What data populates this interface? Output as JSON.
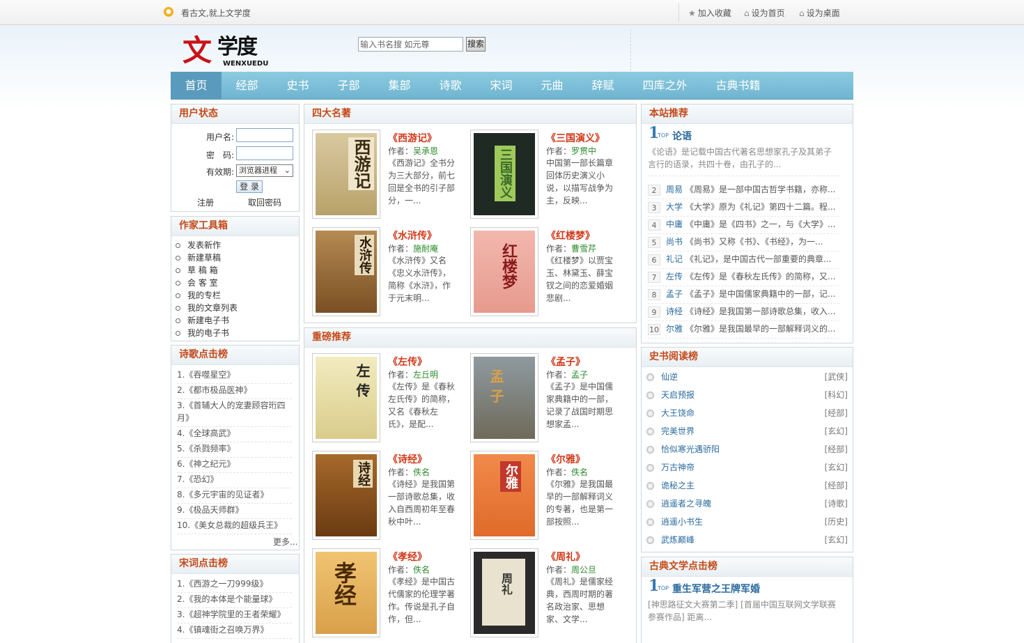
{
  "top": {
    "slogan": "看古文,就上文学度",
    "fav": "加入收藏",
    "home": "设为首页",
    "desk": "设为桌面"
  },
  "logo": {
    "cn_big": "文",
    "cn_small": "学度",
    "en": "WENXUEDU"
  },
  "search": {
    "placeholder": "输入书名搜 如元尊",
    "button": "搜索"
  },
  "nav": [
    "首页",
    "经部",
    "史书",
    "子部",
    "集部",
    "诗歌",
    "宋词",
    "元曲",
    "辞赋",
    "四库之外",
    "古典书籍"
  ],
  "user": {
    "title": "用户状态",
    "username": "用户名:",
    "password": "密　码:",
    "expiry": "有效期:",
    "expiry_value": "浏览器进程",
    "login": "登 录",
    "register": "注册",
    "forgot": "取回密码"
  },
  "tools": {
    "title": "作家工具箱",
    "items": [
      "发表新作",
      "新建草稿",
      "草 稿 箱",
      "会 客 室",
      "我的专栏",
      "我的文章列表",
      "新建电子书",
      "我的电子书"
    ]
  },
  "poem_rank": {
    "title": "诗歌点击榜",
    "items": [
      "1.《吞噬星空》",
      "2.《都市极品医神》",
      "3.《首辅大人的宠妻顾容珩四月》",
      "4.《全球高武》",
      "5.《杀戮频率》",
      "6.《神之纪元》",
      "7.《恐幻》",
      "8.《多元宇宙的见证者》",
      "9.《极品天师群》",
      "10.《美女总裁的超级兵王》"
    ],
    "more": "更多..."
  },
  "song_rank": {
    "title": "宋词点击榜",
    "items": [
      "1.《西游之一刀999级》",
      "2.《我的本体是个能量球》",
      "3.《超神学院里的王者荣耀》",
      "4.《镇魂街之召唤万界》"
    ]
  },
  "classics": {
    "title": "四大名著",
    "books": [
      {
        "title": "《西游记》",
        "author_label": "作者：",
        "author": "吴承恩",
        "desc": "《西游记》全书分为三大部分，前七回是全书的引子部分，一...",
        "cover": "西游记"
      },
      {
        "title": "《三国演义》",
        "author_label": "作者：",
        "author": "罗贯中",
        "desc": "中国第一部长篇章回体历史演义小说，以描写战争为主，反映...",
        "cover": "三国演义"
      },
      {
        "title": "《水浒传》",
        "author_label": "作者：",
        "author": "施耐庵",
        "desc": "《水浒传》又名《忠义水浒传》，简称《水浒》，作于元末明...",
        "cover": "水浒传"
      },
      {
        "title": "《红楼梦》",
        "author_label": "作者：",
        "author": "曹雪芹",
        "desc": "《红楼梦》以贾宝玉、林黛玉、薛宝钗之间的恋爱婚姻悲剧...",
        "cover": "红楼梦"
      }
    ]
  },
  "featured": {
    "title": "重磅推荐",
    "books": [
      {
        "title": "《左传》",
        "author_label": "作者：",
        "author": "左丘明",
        "desc": "《左传》是《春秋左氏传》的简称，又名《春秋左氏》，是配...",
        "cover": "左传"
      },
      {
        "title": "《孟子》",
        "author_label": "作者：",
        "author": "孟子",
        "desc": "《孟子》是中国儒家典籍中的一部，记录了战国时期思想家孟...",
        "cover": "孟子"
      },
      {
        "title": "《诗经》",
        "author_label": "作者：",
        "author": "佚名",
        "desc": "《诗经》是我国第一部诗歌总集，收入自西周初年至春秋中叶...",
        "cover": "诗经"
      },
      {
        "title": "《尔雅》",
        "author_label": "作者：",
        "author": "佚名",
        "desc": "《尔雅》是我国最早的一部解释词义的专著，也是第一部按照...",
        "cover": "尔雅"
      },
      {
        "title": "《孝经》",
        "author_label": "作者：",
        "author": "佚名",
        "desc": "《孝经》是中国古代儒家的伦理学著作。传说是孔子自作，但...",
        "cover": "孝经"
      },
      {
        "title": "《周礼》",
        "author_label": "作者：",
        "author": "周公旦",
        "desc": "《周礼》是儒家经典，西周时期的著名政治家、思想家、文学...",
        "cover": "周礼"
      }
    ]
  },
  "recommend": {
    "title": "本站推荐",
    "top_label": "TOP",
    "top_title": "论语",
    "top_desc": "《论语》是记载中国古代著名思想家孔子及其弟子言行的语录，共四十卷，由孔子的...",
    "items": [
      {
        "n": "2",
        "kw": "周易",
        "txt": "《周易》是一部中国古哲学书籍，亦称..."
      },
      {
        "n": "3",
        "kw": "大学",
        "txt": "《大学》原为《礼记》第四十二篇。程..."
      },
      {
        "n": "4",
        "kw": "中庸",
        "txt": "《中庸》是《四书》之一，与《大学》..."
      },
      {
        "n": "5",
        "kw": "尚书",
        "txt": "《尚书》又称《书》、《书经》，为一..."
      },
      {
        "n": "6",
        "kw": "礼记",
        "txt": "《礼记》，是中国古代一部重要的典章..."
      },
      {
        "n": "7",
        "kw": "左传",
        "txt": "《左传》是《春秋左氏传》的简称，又..."
      },
      {
        "n": "8",
        "kw": "孟子",
        "txt": "《孟子》是中国儒家典籍中的一部，记..."
      },
      {
        "n": "9",
        "kw": "诗经",
        "txt": "《诗经》是我国第一部诗歌总集，收入..."
      },
      {
        "n": "10",
        "kw": "尔雅",
        "txt": "《尔雅》是我国最早的一部解释词义的..."
      }
    ]
  },
  "history": {
    "title": "史书阅读榜",
    "items": [
      {
        "name": "仙逆",
        "cat": "[武侠]"
      },
      {
        "name": "天启预报",
        "cat": "[科幻]"
      },
      {
        "name": "大王饶命",
        "cat": "[经部]"
      },
      {
        "name": "完美世界",
        "cat": "[玄幻]"
      },
      {
        "name": "恰似寒光遇骄阳",
        "cat": "[经部]"
      },
      {
        "name": "万古神帝",
        "cat": "[玄幻]"
      },
      {
        "name": "诡秘之主",
        "cat": "[经部]"
      },
      {
        "name": "逍遥者之寻魄",
        "cat": "[诗歌]"
      },
      {
        "name": "逍遥小书生",
        "cat": "[历史]"
      },
      {
        "name": "武炼巅峰",
        "cat": "[玄幻]"
      }
    ]
  },
  "classic_rank": {
    "title": "古典文学点击榜",
    "top_label": "TOP",
    "top_title": "重生军营之王牌军婚",
    "top_desc": "[神思路征文大赛第二季] [首届中国互联网文学联赛参赛作品] 距离..."
  }
}
